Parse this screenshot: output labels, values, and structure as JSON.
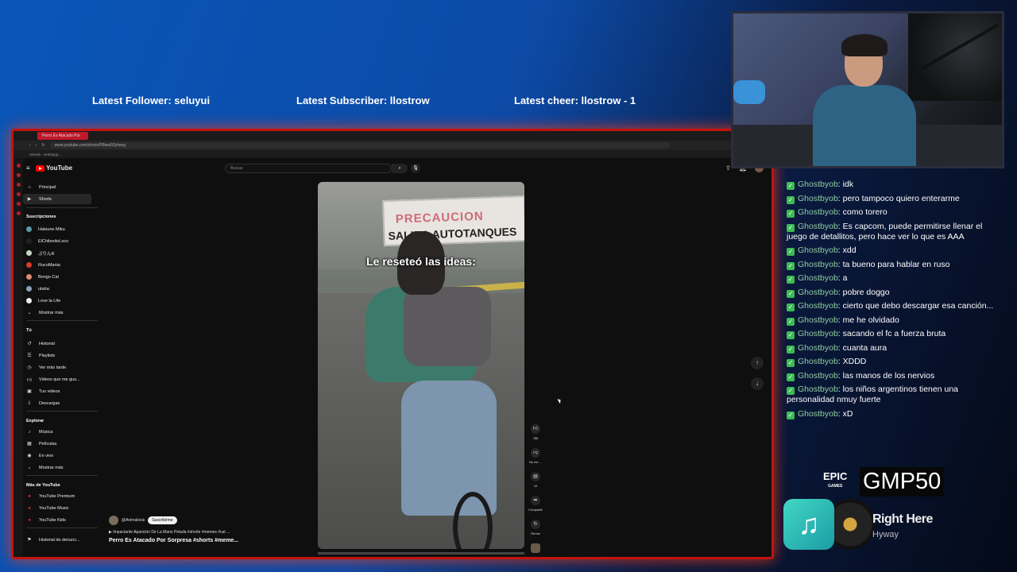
{
  "stream_stats": {
    "follower": "Latest Follower: seluyui",
    "subscriber": "Latest Subscriber: llostrow",
    "cheer": "Latest cheer: llostrow - 1"
  },
  "browser": {
    "tab_title": "Perro Es Atacado Por",
    "url": "www.youtube.com/shorts/P8ww02yheeg",
    "bookmark": "GitHub - wreldopp..."
  },
  "youtube": {
    "logo": "YouTube",
    "search_placeholder": "Buscar",
    "nav": [
      {
        "label": "Principal",
        "icon": "home-icon"
      },
      {
        "label": "Shorts",
        "icon": "shorts-icon"
      }
    ],
    "subs_header": "Suscripciones",
    "subscriptions": [
      {
        "label": "Hatsune Miku",
        "color": "#5a9aa8"
      },
      {
        "label": "ElChilenitoLoco",
        "color": "#222222"
      },
      {
        "label": "ぷりんR",
        "color": "#c8d8c0"
      },
      {
        "label": "RucoMania",
        "color": "#d83b2a"
      },
      {
        "label": "Bongo Cat",
        "color": "#e08a70"
      },
      {
        "label": "utaha",
        "color": "#8aa0b8"
      },
      {
        "label": "Love la Life",
        "color": "#f0f0f0"
      },
      {
        "label": "Mostrar más",
        "color": ""
      }
    ],
    "you_header": "Tú",
    "you_items": [
      {
        "label": "Historial",
        "icon": "history-icon"
      },
      {
        "label": "Playlists",
        "icon": "playlist-icon"
      },
      {
        "label": "Ver más tarde",
        "icon": "clock-icon"
      },
      {
        "label": "Videos que me gus...",
        "icon": "thumb-up-icon"
      },
      {
        "label": "Tus videos",
        "icon": "video-icon"
      },
      {
        "label": "Descargas",
        "icon": "download-icon"
      }
    ],
    "explore_header": "Explorar",
    "explore_items": [
      {
        "label": "Música",
        "icon": "music-icon"
      },
      {
        "label": "Películas",
        "icon": "film-icon"
      },
      {
        "label": "En vivo",
        "icon": "live-icon"
      },
      {
        "label": "Mostrar más",
        "icon": "chevron-down-icon"
      }
    ],
    "more_header": "Más de YouTube",
    "more_items": [
      {
        "label": "YouTube Premium"
      },
      {
        "label": "YouTube Music"
      },
      {
        "label": "YouTube Kids"
      }
    ],
    "report_item": "Historial de denunc...",
    "short": {
      "sign_line1": "PRECAUCION",
      "sign_line2": "SALIDA AUTOTANQUES",
      "caption": "Le reseteó las ideas:",
      "channel": "@Animalosis",
      "subscribe": "Suscribirme",
      "description": "Impactante Aparición De La Mano Pelada #shorts #memes #cat ...",
      "title": "Perro Es Atacado Por Sorpresa #shorts #meme...",
      "likes": "786",
      "dislike_label": "No me ...",
      "comments": "10",
      "share_label": "Compartir",
      "remix_label": "Remix"
    }
  },
  "chat": [
    {
      "user": "Ghostbyob",
      "text": "idk"
    },
    {
      "user": "Ghostbyob",
      "text": "pero tampoco quiero enterarme"
    },
    {
      "user": "Ghostbyob",
      "text": "como torero"
    },
    {
      "user": "Ghostbyob",
      "text": "Es capcom, puede permitirse llenar el juego de detallitos, pero hace ver lo que es AAA"
    },
    {
      "user": "Ghostbyob",
      "text": "xdd"
    },
    {
      "user": "Ghostbyob",
      "text": "ta bueno para hablar en ruso"
    },
    {
      "user": "Ghostbyob",
      "text": "a"
    },
    {
      "user": "Ghostbyob",
      "text": "pobre doggo"
    },
    {
      "user": "Ghostbyob",
      "text": "cierto que debo descargar esa canción..."
    },
    {
      "user": "Ghostbyob",
      "text": "me he olvidado"
    },
    {
      "user": "Ghostbyob",
      "text": "sacando el fc a fuerza bruta"
    },
    {
      "user": "Ghostbyob",
      "text": "cuanta aura"
    },
    {
      "user": "Ghostbyob",
      "text": "XDDD"
    },
    {
      "user": "Ghostbyob",
      "text": "las manos de los nervios"
    },
    {
      "user": "Ghostbyob",
      "text": "los niños argentinos tienen una personalidad nmuy fuerte"
    },
    {
      "user": "Ghostbyob",
      "text": "xD"
    }
  ],
  "promo": {
    "brand": "EPIC",
    "brand_sub": "GAMES",
    "code": "GMP50"
  },
  "now_playing": {
    "title": "Right Here",
    "artist": "Hyway"
  }
}
